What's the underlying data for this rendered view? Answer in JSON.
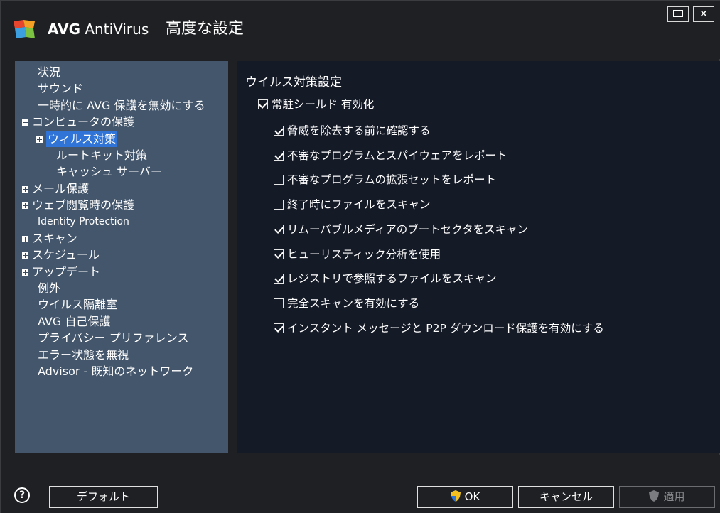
{
  "app": {
    "brand_bold": "AVG",
    "brand_rest": " AntiVirus",
    "title": "高度な設定",
    "close_glyph": "×"
  },
  "sidebar": {
    "items": [
      {
        "label": "状況",
        "level": 1
      },
      {
        "label": "サウンド",
        "level": 1
      },
      {
        "label": "一時的に AVG 保護を無効にする",
        "level": 1
      },
      {
        "label": "コンピュータの保護",
        "level": 0,
        "expander": "minus"
      },
      {
        "label": "ウィルス対策",
        "level": 1,
        "expander": "plus",
        "selected": true
      },
      {
        "label": "ルートキット対策",
        "level": 2
      },
      {
        "label": "キャッシュ サーバー",
        "level": 2
      },
      {
        "label": "メール保護",
        "level": 0,
        "expander": "plus"
      },
      {
        "label": "ウェブ閲覧時の保護",
        "level": 0,
        "expander": "plus"
      },
      {
        "label": "Identity Protection",
        "level": 1,
        "en": true
      },
      {
        "label": "スキャン",
        "level": 0,
        "expander": "plus"
      },
      {
        "label": "スケジュール",
        "level": 0,
        "expander": "plus"
      },
      {
        "label": "アップデート",
        "level": 0,
        "expander": "plus"
      },
      {
        "label": "例外",
        "level": 1
      },
      {
        "label": "ウイルス隔離室",
        "level": 1
      },
      {
        "label": "AVG 自己保護",
        "level": 1
      },
      {
        "label": "プライバシー プリファレンス",
        "level": 1
      },
      {
        "label": "エラー状態を無視",
        "level": 1
      },
      {
        "label": "Advisor - 既知のネットワーク",
        "level": 1
      }
    ]
  },
  "main": {
    "section_title": "ウイルス対策設定",
    "resident_shield": {
      "label": "常駐シールド 有効化",
      "checked": true
    },
    "options": [
      {
        "label": "脅威を除去する前に確認する",
        "checked": true
      },
      {
        "label": "不審なプログラムとスパイウェアをレポート",
        "checked": true
      },
      {
        "label": "不審なプログラムの拡張セットをレポート",
        "checked": false
      },
      {
        "label": "終了時にファイルをスキャン",
        "checked": false
      },
      {
        "label": "リムーバブルメディアのブートセクタをスキャン",
        "checked": true
      },
      {
        "label": "ヒューリスティック分析を使用",
        "checked": true
      },
      {
        "label": "レジストリで参照するファイルをスキャン",
        "checked": true
      },
      {
        "label": "完全スキャンを有効にする",
        "checked": false
      },
      {
        "label": "インスタント メッセージと P2P ダウンロード保護を有効にする",
        "checked": true
      }
    ]
  },
  "footer": {
    "help_glyph": "?",
    "default_label": "デフォルト",
    "ok_label": "OK",
    "cancel_label": "キャンセル",
    "apply_label": "適用",
    "apply_enabled": false
  },
  "colors": {
    "sidebar_bg": "#44566c",
    "content_bg": "#151a27",
    "selection": "#2f74d6",
    "window_bg": "#1e2023"
  }
}
